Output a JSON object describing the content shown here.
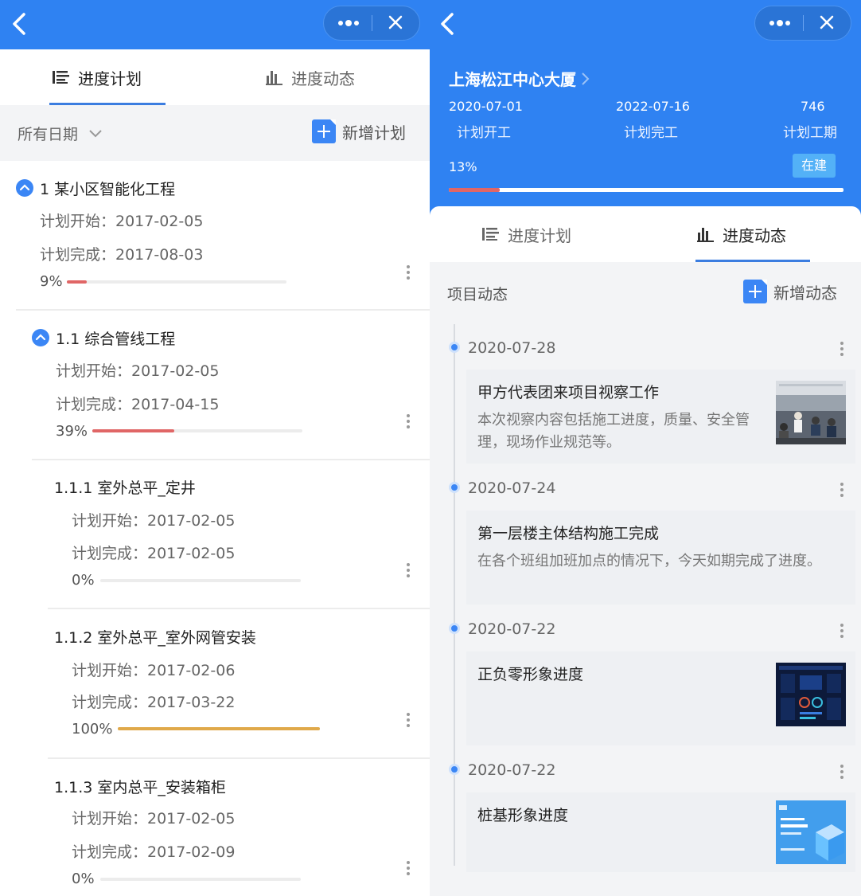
{
  "left": {
    "tabs": [
      {
        "label": "进度计划",
        "active": true
      },
      {
        "label": "进度动态",
        "active": false
      }
    ],
    "filter_label": "所有日期",
    "add_label": "新增计划",
    "items": [
      {
        "title": "1 某小区智能化工程",
        "start": "计划开始：2017-02-05",
        "end": "计划完成：2017-08-03",
        "pct": "9%",
        "progress": 0.09,
        "color": "#e06666"
      },
      {
        "title": "1.1 综合管线工程",
        "start": "计划开始：2017-02-05",
        "end": "计划完成：2017-04-15",
        "pct": "39%",
        "progress": 0.39,
        "color": "#e06666"
      },
      {
        "title": "1.1.1 室外总平_定井",
        "start": "计划开始：2017-02-05",
        "end": "计划完成：2017-02-05",
        "pct": "0%",
        "progress": 0,
        "color": "#e06666"
      },
      {
        "title": "1.1.2 室外总平_室外网管安装",
        "start": "计划开始：2017-02-06",
        "end": "计划完成：2017-03-22",
        "pct": "100%",
        "progress": 1.0,
        "color": "#e0a94a"
      },
      {
        "title": "1.1.3 室内总平_安装箱柜",
        "start": "计划开始：2017-02-05",
        "end": "计划完成：2017-02-09",
        "pct": "0%",
        "progress": 0,
        "color": "#e06666"
      }
    ]
  },
  "right": {
    "project_title": "上海松江中心大厦",
    "stats": [
      {
        "value": "2020-07-01",
        "label": "计划开工"
      },
      {
        "value": "2022-07-16",
        "label": "计划完工"
      },
      {
        "value": "746",
        "label": "计划工期"
      }
    ],
    "progress_text": "13%",
    "progress": 0.13,
    "status": "在建",
    "tabs": [
      {
        "label": "进度计划",
        "active": false
      },
      {
        "label": "进度动态",
        "active": true
      }
    ],
    "section_label": "项目动态",
    "add_label": "新增动态",
    "events": [
      {
        "date": "2020-07-28",
        "title": "甲方代表团来项目视察工作",
        "text": "本次视察内容包括施工进度，质量、安全管理，现场作业规范等。",
        "has_image": true
      },
      {
        "date": "2020-07-24",
        "title": "第一层楼主体结构施工完成",
        "text": "在各个班组加班加点的情况下，今天如期完成了进度。",
        "has_image": false
      },
      {
        "date": "2020-07-22",
        "title": "正负零形象进度",
        "text": "",
        "has_image": true
      },
      {
        "date": "2020-07-22",
        "title": "桩基形象进度",
        "text": "",
        "has_image": true
      }
    ]
  },
  "colors": {
    "brand": "#2f82f2",
    "accent": "#3b86f5",
    "progress_red": "#e06666",
    "progress_orange": "#e0a94a"
  }
}
